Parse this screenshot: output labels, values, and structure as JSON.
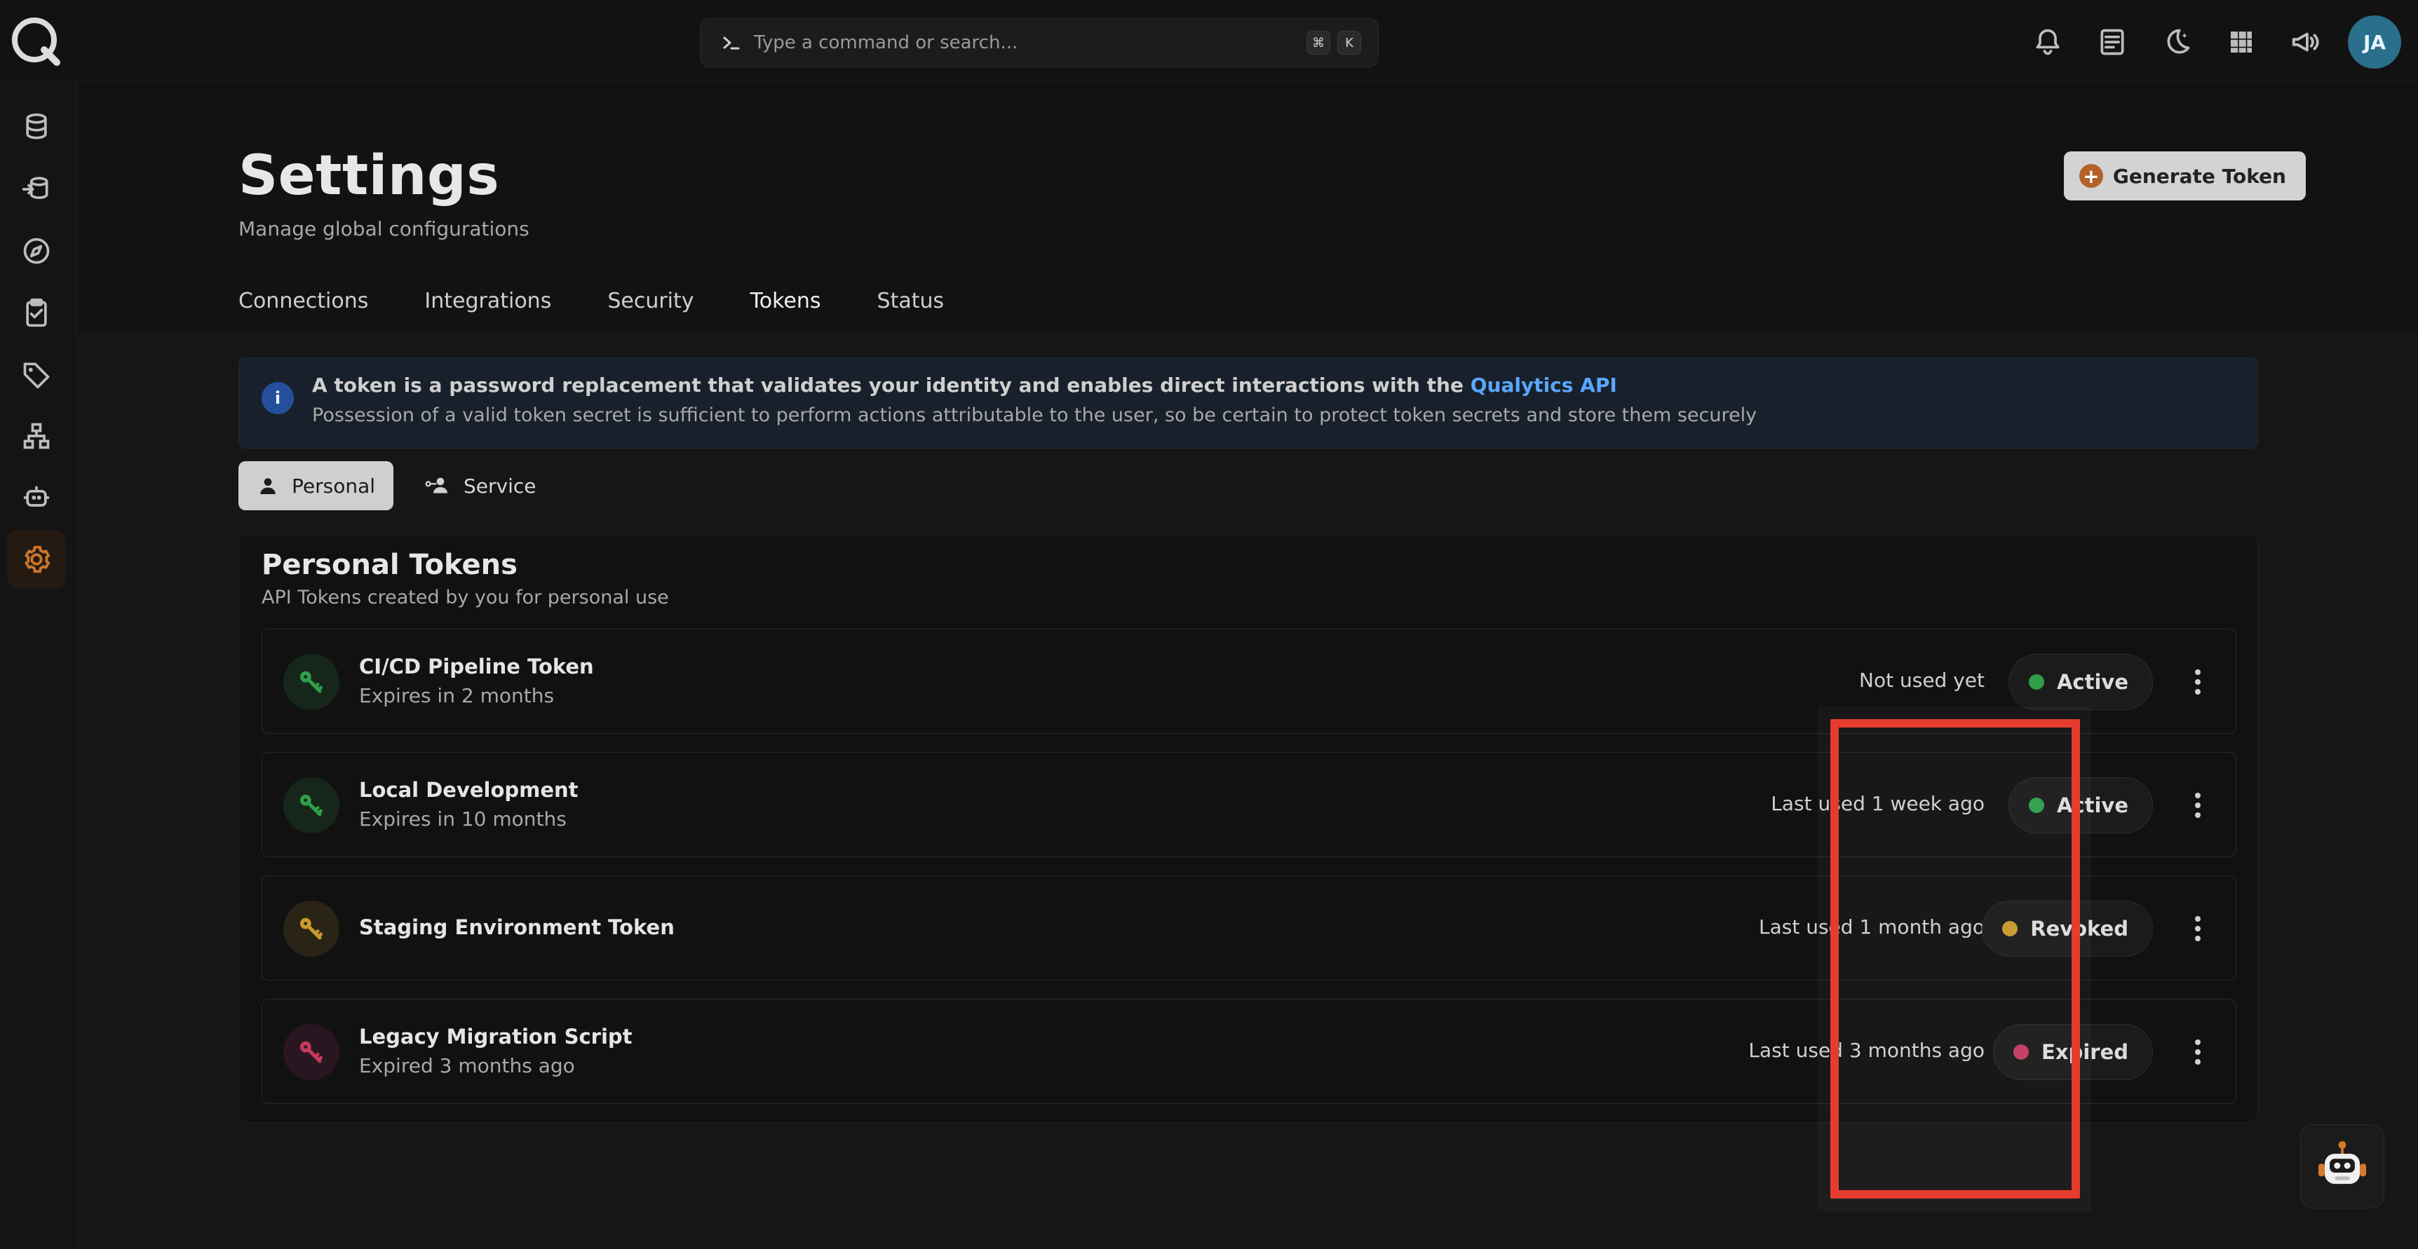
{
  "app": {
    "command_placeholder": "Type a command or search...",
    "shortcut_keys": [
      "⌘",
      "K"
    ],
    "user_initials": "JA"
  },
  "page": {
    "title": "Settings",
    "subtitle": "Manage global configurations",
    "generate_button": "Generate Token"
  },
  "tabs": [
    {
      "label": "Connections",
      "active": false
    },
    {
      "label": "Integrations",
      "active": false
    },
    {
      "label": "Security",
      "active": false
    },
    {
      "label": "Tokens",
      "active": true
    },
    {
      "label": "Status",
      "active": false
    }
  ],
  "info": {
    "line1_prefix": "A token is a password replacement that validates your identity and enables direct interactions with the",
    "line1_link": "Qualytics API",
    "line2": "Possession of a valid token secret is sufficient to perform actions attributable to the user, so be certain to protect token secrets and store them securely"
  },
  "segmented": {
    "personal": "Personal",
    "service": "Service",
    "active": "personal"
  },
  "panel": {
    "title": "Personal Tokens",
    "subtitle": "API Tokens created by you for personal use",
    "rows": [
      {
        "name": "CI/CD Pipeline Token",
        "expires": "Expires in 2 months",
        "usage": "Not used yet",
        "status": "Active",
        "color": "#2f9f4a"
      },
      {
        "name": "Local Development",
        "expires": "Expires in 10 months",
        "usage": "Last used 1 week ago",
        "status": "Active",
        "color": "#2f9f4a"
      },
      {
        "name": "Staging Environment Token",
        "expires": "",
        "usage": "Last used 1 month ago",
        "status": "Revoked",
        "color": "#c99a2c"
      },
      {
        "name": "Legacy Migration Script",
        "expires": "Expired 3 months ago",
        "usage": "Last used 3 months ago",
        "status": "Expired",
        "color": "#c53a5e"
      }
    ]
  }
}
